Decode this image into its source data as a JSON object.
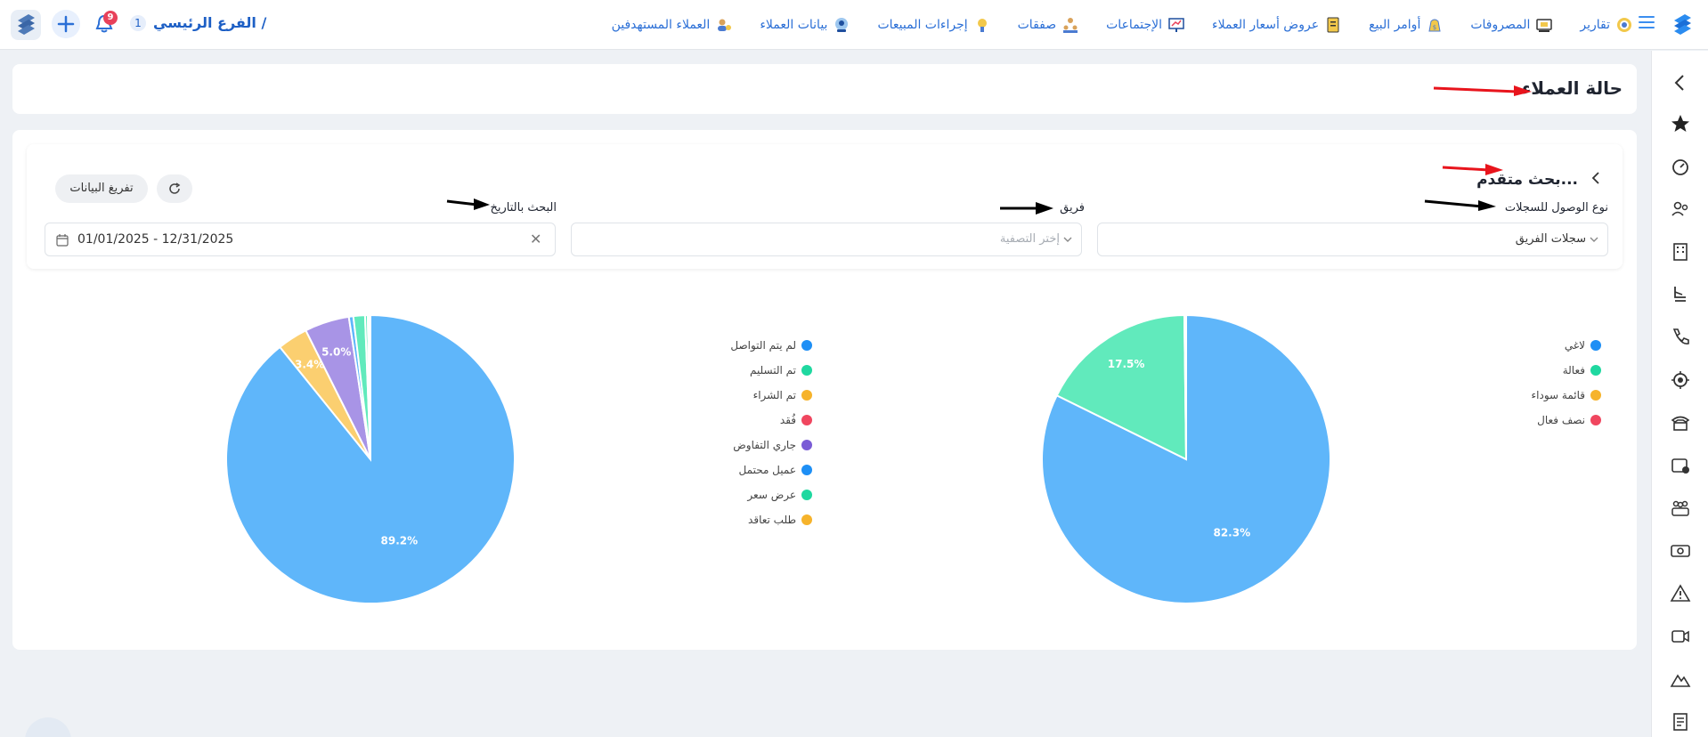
{
  "header": {
    "nav": [
      {
        "label": "العملاء المستهدفين",
        "icon": "target-customers-icon"
      },
      {
        "label": "بيانات العملاء",
        "icon": "customer-data-icon"
      },
      {
        "label": "إجراءات المبيعات",
        "icon": "sales-actions-icon"
      },
      {
        "label": "صفقات",
        "icon": "deals-icon"
      },
      {
        "label": "الإجتماعات",
        "icon": "meetings-icon"
      },
      {
        "label": "عروض أسعار العملاء",
        "icon": "quotes-icon"
      },
      {
        "label": "أوامر البيع",
        "icon": "sales-orders-icon"
      },
      {
        "label": "المصروفات",
        "icon": "expenses-icon"
      },
      {
        "label": "تقارير",
        "icon": "reports-icon"
      }
    ],
    "branch": {
      "label": "الفرع الرئيسي /",
      "count": "1"
    },
    "notifications": {
      "count": "9"
    }
  },
  "page": {
    "title": "حالة العملاء"
  },
  "filters": {
    "advanced_title": "بحث متقدم...",
    "access_type": {
      "label": "نوع الوصول للسجلات",
      "value": "سجلات الفريق"
    },
    "team": {
      "label": "فريق",
      "placeholder": "إختر التصفية"
    },
    "date": {
      "label": "البحث بالتاريخ",
      "value": "01/01/2025 - 12/31/2025"
    },
    "export_label": "تفريغ البيانات"
  },
  "colors": {
    "accent": "#2b6fd6",
    "red_arrow": "#e8141c",
    "black_arrow": "#000000"
  },
  "chart_data": [
    {
      "type": "pie",
      "legend": [
        "لاغي",
        "فعالة",
        "قائمة سوداء",
        "نصف فعال"
      ],
      "legend_colors": [
        "#1e8ff5",
        "#1fd8a0",
        "#f6b32b",
        "#f0465f"
      ],
      "slices": [
        {
          "name": "لاغي",
          "value": 82.3,
          "color": "#5fb6fa",
          "label": "82.3%"
        },
        {
          "name": "فعالة",
          "value": 17.5,
          "color": "#61eabc",
          "label": "17.5%"
        },
        {
          "name": "قائمة سوداء",
          "value": 0.1,
          "color": "#fbcf70",
          "label": ""
        },
        {
          "name": "نصف فعال",
          "value": 0.1,
          "color": "#f78a98",
          "label": ""
        }
      ]
    },
    {
      "type": "pie",
      "legend": [
        "لم يتم التواصل",
        "تم التسليم",
        "تم الشراء",
        "فُقد",
        "جاري التفاوض",
        "عميل محتمل",
        "عرض سعر",
        "طلب تعاقد"
      ],
      "legend_colors": [
        "#1e8ff5",
        "#1fd8a0",
        "#f6b32b",
        "#f0465f",
        "#7a5cd6",
        "#1e8ff5",
        "#1fd8a0",
        "#f6b32b"
      ],
      "slices": [
        {
          "name": "لم يتم التواصل",
          "value": 89.2,
          "color": "#5fb6fa",
          "label": "89.2%"
        },
        {
          "name": "تم الشراء",
          "value": 3.4,
          "color": "#fbcf70",
          "label": "3.4%"
        },
        {
          "name": "جاري التفاوض",
          "value": 5.0,
          "color": "#a894e6",
          "label": "5.0%"
        },
        {
          "name": "عميل محتمل",
          "value": 0.5,
          "color": "#5fb6fa",
          "label": ""
        },
        {
          "name": "عرض سعر",
          "value": 1.3,
          "color": "#61eabc",
          "label": ""
        },
        {
          "name": "تم التسليم",
          "value": 0.3,
          "color": "#61eabc",
          "label": ""
        },
        {
          "name": "فُقد",
          "value": 0.2,
          "color": "#f78a98",
          "label": ""
        },
        {
          "name": "طلب تعاقد",
          "value": 0.1,
          "color": "#fbcf70",
          "label": ""
        }
      ]
    }
  ]
}
